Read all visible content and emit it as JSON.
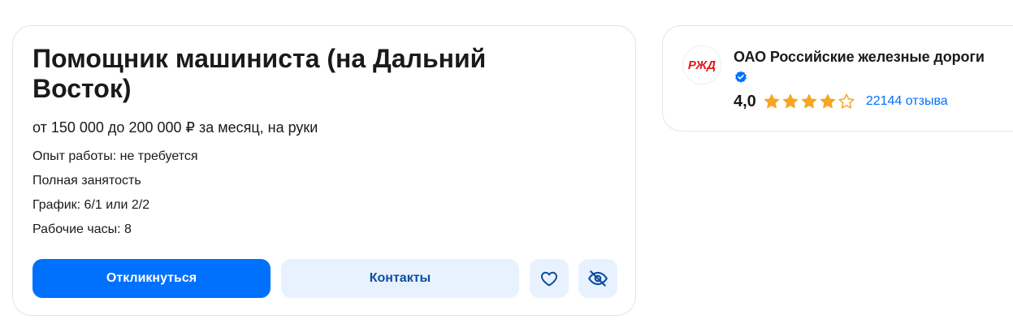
{
  "vacancy": {
    "title": "Помощник машиниста (на Дальний Восток)",
    "salary": "от 150 000 до 200 000 ₽ за месяц, на руки",
    "experience": "Опыт работы: не требуется",
    "employment": "Полная занятость",
    "schedule": "График: 6/1 или 2/2",
    "hours": "Рабочие часы: 8"
  },
  "actions": {
    "apply_label": "Откликнуться",
    "contacts_label": "Контакты",
    "favorite_icon": "heart-icon",
    "hide_icon": "eye-off-icon"
  },
  "company": {
    "name": "ОАО Российские железные дороги",
    "logo_text": "РЖД",
    "verified_icon": "verified-badge-icon",
    "rating": "4,0",
    "rating_stars": 4,
    "rating_max": 5,
    "reviews": "22144 отзыва"
  },
  "colors": {
    "primary": "#0070ff",
    "secondary_bg": "#e8f2ff",
    "secondary_text": "#0d4d9e",
    "star": "#f5a623",
    "logo_red": "#e21a1a"
  }
}
